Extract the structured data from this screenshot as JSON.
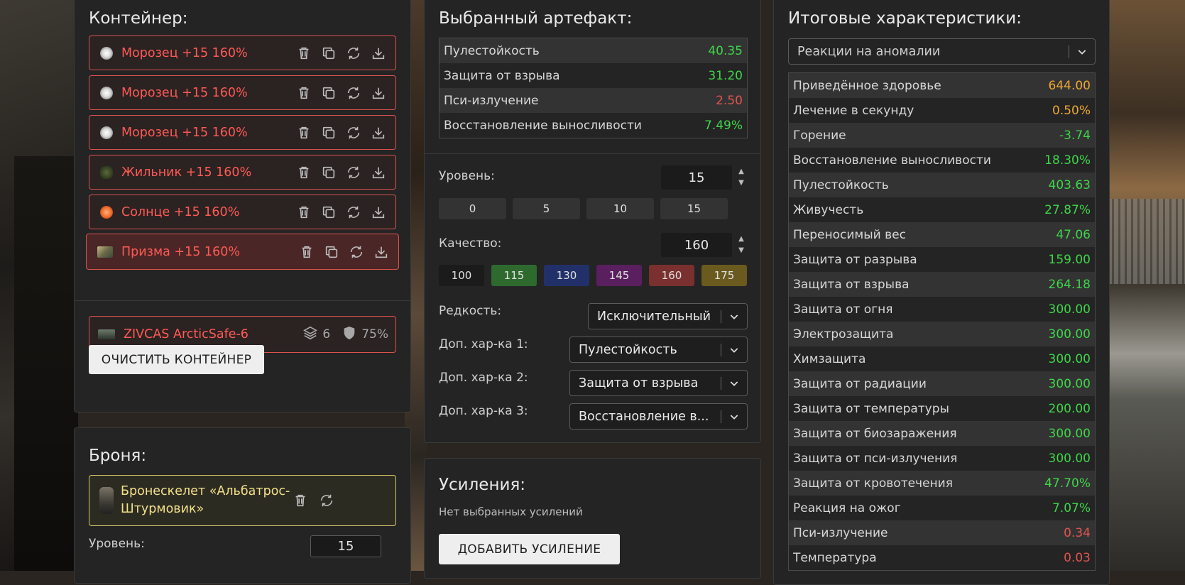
{
  "container": {
    "title": "Контейнер:",
    "items": [
      {
        "name": "Морозец +15 160%",
        "icon": "frost-artifact-icon"
      },
      {
        "name": "Морозец +15 160%",
        "icon": "frost-artifact-icon"
      },
      {
        "name": "Морозец +15 160%",
        "icon": "frost-artifact-icon"
      },
      {
        "name": "Жильник +15 160%",
        "icon": "zhilnik-artifact-icon"
      },
      {
        "name": "Солнце +15 160%",
        "icon": "sun-artifact-icon"
      },
      {
        "name": "Призма +15 160%",
        "icon": "prism-artifact-icon"
      }
    ],
    "box": {
      "name": "ZIVCAS ArcticSafe-6",
      "slots": "6",
      "protection": "75%"
    },
    "clear_label": "ОЧИСТИТЬ КОНТЕЙНЕР"
  },
  "armor": {
    "title": "Броня:",
    "name": "Бронескелет «Альбатрос-Штурмовик»",
    "level_label": "Уровень:",
    "level_value": "15"
  },
  "artifact": {
    "title": "Выбранный артефакт:",
    "stats": [
      {
        "label": "Пулестойкость",
        "value": "40.35",
        "color": "green"
      },
      {
        "label": "Защита от взрыва",
        "value": "31.20",
        "color": "green"
      },
      {
        "label": "Пси-излучение",
        "value": "2.50",
        "color": "red"
      },
      {
        "label": "Восстановление выносливости",
        "value": "7.49%",
        "color": "green"
      }
    ],
    "level_label": "Уровень:",
    "level_value": "15",
    "level_presets": [
      "0",
      "5",
      "10",
      "15"
    ],
    "quality_label": "Качество:",
    "quality_value": "160",
    "quality_presets": [
      {
        "label": "100",
        "color": "#1b1b1b"
      },
      {
        "label": "115",
        "color": "#2e6a2e"
      },
      {
        "label": "130",
        "color": "#22306a"
      },
      {
        "label": "145",
        "color": "#5a1f5e"
      },
      {
        "label": "160",
        "color": "#7a302e"
      },
      {
        "label": "175",
        "color": "#6a5a1e"
      }
    ],
    "rarity_label": "Редкость:",
    "rarity_value": "Исключительный",
    "extra1_label": "Доп. хар-ка 1:",
    "extra1_value": "Пулестойкость",
    "extra2_label": "Доп. хар-ка 2:",
    "extra2_value": "Защита от взрыва",
    "extra3_label": "Доп. хар-ка 3:",
    "extra3_value": "Восстановление в..."
  },
  "boosts": {
    "title": "Усиления:",
    "empty_text": "Нет выбранных усилений",
    "add_label": "ДОБАВИТЬ УСИЛЕНИЕ"
  },
  "totals": {
    "title": "Итоговые характеристики:",
    "filter_value": "Реакции на аномалии",
    "rows": [
      {
        "label": "Приведённое здоровье",
        "value": "644.00",
        "color": "orange"
      },
      {
        "label": "Лечение в секунду",
        "value": "0.50%",
        "color": "orange"
      },
      {
        "label": "Горение",
        "value": "-3.74",
        "color": "green"
      },
      {
        "label": "Восстановление выносливости",
        "value": "18.30%",
        "color": "green"
      },
      {
        "label": "Пулестойкость",
        "value": "403.63",
        "color": "green"
      },
      {
        "label": "Живучесть",
        "value": "27.87%",
        "color": "green"
      },
      {
        "label": "Переносимый вес",
        "value": "47.06",
        "color": "green"
      },
      {
        "label": "Защита от разрыва",
        "value": "159.00",
        "color": "green"
      },
      {
        "label": "Защита от взрыва",
        "value": "264.18",
        "color": "green"
      },
      {
        "label": "Защита от огня",
        "value": "300.00",
        "color": "green"
      },
      {
        "label": "Электрозащита",
        "value": "300.00",
        "color": "green"
      },
      {
        "label": "Химзащита",
        "value": "300.00",
        "color": "green"
      },
      {
        "label": "Защита от радиации",
        "value": "300.00",
        "color": "green"
      },
      {
        "label": "Защита от температуры",
        "value": "200.00",
        "color": "green"
      },
      {
        "label": "Защита от биозаражения",
        "value": "300.00",
        "color": "green"
      },
      {
        "label": "Защита от пси-излучения",
        "value": "300.00",
        "color": "green"
      },
      {
        "label": "Защита от кровотечения",
        "value": "47.70%",
        "color": "green"
      },
      {
        "label": "Реакция на ожог",
        "value": "7.07%",
        "color": "green"
      },
      {
        "label": "Пси-излучение",
        "value": "0.34",
        "color": "red"
      },
      {
        "label": "Температура",
        "value": "0.03",
        "color": "red"
      }
    ]
  }
}
